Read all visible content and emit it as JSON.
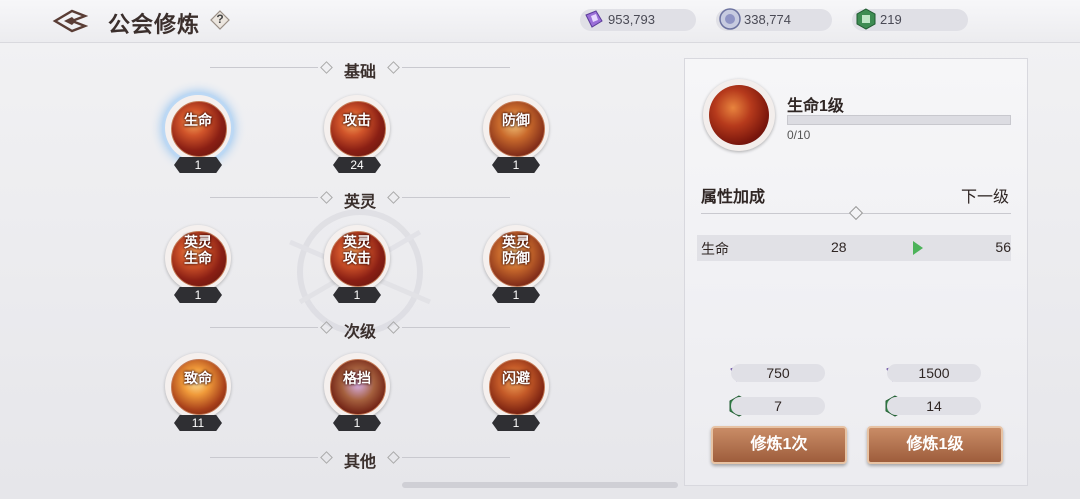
{
  "header": {
    "title": "公会修炼",
    "help_label": "?",
    "resources": [
      {
        "icon": "purple-crystal-icon",
        "value": "953,793"
      },
      {
        "icon": "silver-coin-icon",
        "value": "338,774"
      },
      {
        "icon": "guild-contribution-icon",
        "value": "219"
      }
    ]
  },
  "sections": [
    {
      "title": "基础",
      "nodes": [
        {
          "label": "生命",
          "level": "1",
          "selected": true
        },
        {
          "label": "攻击",
          "level": "24"
        },
        {
          "label": "防御",
          "level": "1"
        }
      ]
    },
    {
      "title": "英灵",
      "nodes": [
        {
          "label": "英灵\n生命",
          "line1": "英灵",
          "line2": "生命",
          "level": "1"
        },
        {
          "label": "英灵\n攻击",
          "line1": "英灵",
          "line2": "攻击",
          "level": "1"
        },
        {
          "label": "英灵\n防御",
          "line1": "英灵",
          "line2": "防御",
          "level": "1"
        }
      ]
    },
    {
      "title": "次级",
      "nodes": [
        {
          "label": "致命",
          "level": "11"
        },
        {
          "label": "格挡",
          "level": "1"
        },
        {
          "label": "闪避",
          "level": "1"
        }
      ]
    },
    {
      "title": "其他",
      "nodes": []
    }
  ],
  "detail": {
    "title": "生命1级",
    "progress_text": "0/10",
    "progress_fraction": 0,
    "attr_header": "属性加成",
    "next_header": "下一级",
    "stat": {
      "name": "生命",
      "current": "28",
      "next": "56"
    },
    "costs": {
      "once": {
        "crystal": "750",
        "contribution": "7"
      },
      "level": {
        "crystal": "1500",
        "contribution": "14"
      }
    },
    "buttons": {
      "train_once": "修炼1次",
      "train_level": "修炼1级"
    }
  },
  "colors": {
    "accent": "#a8623f",
    "level_badge": "#2f2f33",
    "arrow": "#4db35a",
    "selection_glow": "#9ec8f0"
  }
}
